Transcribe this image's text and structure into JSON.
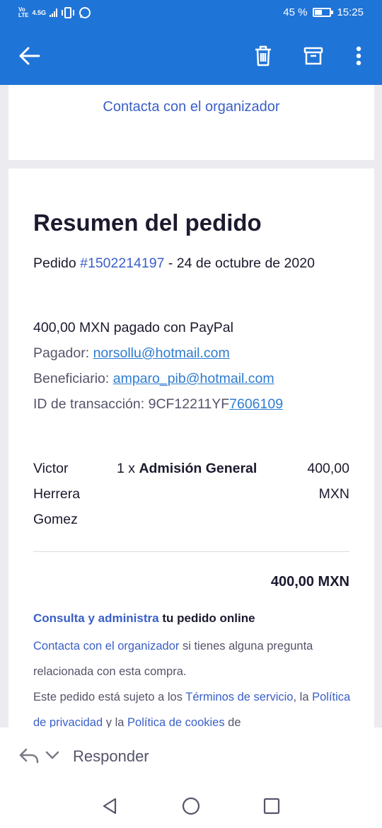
{
  "status_bar": {
    "carrier_top": "Vo",
    "carrier_bottom": "LTE",
    "network": "4.5G",
    "battery_percent": "45 %",
    "battery_level": 0.45,
    "time": "15:25",
    "icons": [
      "signal-icon",
      "vibrate-icon",
      "whatsapp-icon",
      "battery-icon"
    ]
  },
  "app_bar": {
    "background": "#1f74d8",
    "icons": [
      "back-arrow-icon",
      "trash-icon",
      "archive-icon",
      "more-vert-icon"
    ]
  },
  "email": {
    "top_link": "Contacta con el organizador",
    "title": "Resumen del pedido",
    "order_prefix": "Pedido ",
    "order_number": "#1502214197",
    "order_date": " - 24 de octubre de 2020",
    "payment": {
      "summary": "400,00 MXN pagado con PayPal",
      "payer_label": "Pagador: ",
      "payer_email": "norsollu@hotmail.com",
      "beneficiary_label": "Beneficiario: ",
      "beneficiary_email": "amparo_pib@hotmail.com",
      "transaction_label": "ID de transacción: ",
      "transaction_id_plain": "9CF12211YF",
      "transaction_id_link": "7606109"
    },
    "item": {
      "name_lines": [
        "Victor",
        "Herrera",
        "Gomez"
      ],
      "quantity": "1 x ",
      "ticket": "Admisión General",
      "price_lines": [
        "400,00",
        "MXN"
      ]
    },
    "total": "400,00 MXN",
    "manage": {
      "link": "Consulta y administra",
      "text": " tu pedido online"
    },
    "fine_print": {
      "contact_link": "Contacta con el organizador",
      "contact_text": " si tienes alguna pregunta relacionada con esta compra.",
      "terms_prefix": "Este pedido está sujeto a los ",
      "terms_link": "Términos de servicio",
      "terms_mid": ", la ",
      "privacy_link": "Política de privacidad",
      "privacy_mid": " y la ",
      "cookies_link": "Política de cookies",
      "cookies_suffix": " de"
    }
  },
  "reply_bar": {
    "label": "Responder",
    "icons": [
      "reply-icon",
      "chevron-down-icon"
    ]
  },
  "nav_bar": {
    "icons": [
      "nav-back-icon",
      "nav-home-icon",
      "nav-recents-icon"
    ]
  }
}
